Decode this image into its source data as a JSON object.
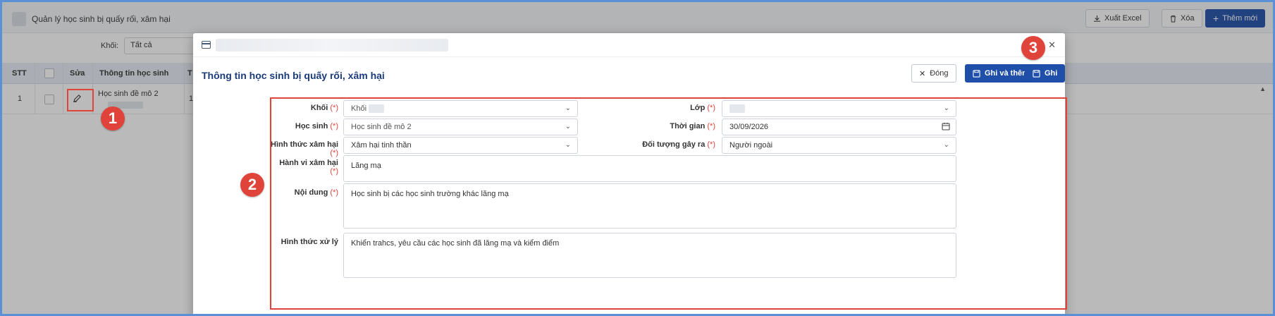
{
  "background": {
    "app_title": "Quản lý học sinh bị quấy rối, xâm hại",
    "buttons": {
      "export": "Xuất Excel",
      "delete": "Xóa",
      "add_new": "Thêm mới"
    },
    "filter": {
      "label": "Khối:",
      "value": "Tất cả"
    },
    "table": {
      "headers": {
        "stt": "STT",
        "edit": "Sửa",
        "student_info": "Thông tin học sinh",
        "next_col_fragment": "T"
      },
      "rows": [
        {
          "stt": "1",
          "student_name": "Học sinh đề mô 2",
          "next_col_fragment": "1"
        }
      ]
    }
  },
  "callouts": {
    "one": "1",
    "two": "2",
    "three": "3"
  },
  "modal": {
    "heading": "Thông tin học sinh bị quấy rối, xâm hại",
    "buttons": {
      "close": "Đóng",
      "save_and_add": "Ghi và thêm",
      "save": "Ghi"
    },
    "required_marker": "(*)",
    "form": {
      "grade": {
        "label": "Khối",
        "value": "Khối"
      },
      "class": {
        "label": "Lớp",
        "value": ""
      },
      "student": {
        "label": "Học sinh",
        "value": "Học sinh đề mô 2"
      },
      "time": {
        "label": "Thời gian",
        "value": "30/09/2026"
      },
      "abuse_type": {
        "label": "Hình thức xâm hại",
        "value": "Xâm hại tinh thần"
      },
      "perpetrator": {
        "label": "Đối tượng gây ra",
        "value": "Người ngoài"
      },
      "behavior": {
        "label": "Hành vi xâm hại",
        "value": "Lăng mạ"
      },
      "content": {
        "label": "Nội dung",
        "value": "Học sinh bị các học sinh trường khác lăng mạ"
      },
      "handling": {
        "label": "Hình thức xử lý",
        "value": "Khiển trahcs, yêu cầu các học sinh đã lăng mạ và kiểm điểm"
      }
    }
  },
  "colors": {
    "primary": "#1f4fa8",
    "callout": "#e0433a",
    "heading": "#1a3c7a",
    "frame_border": "#5b8fd6"
  }
}
